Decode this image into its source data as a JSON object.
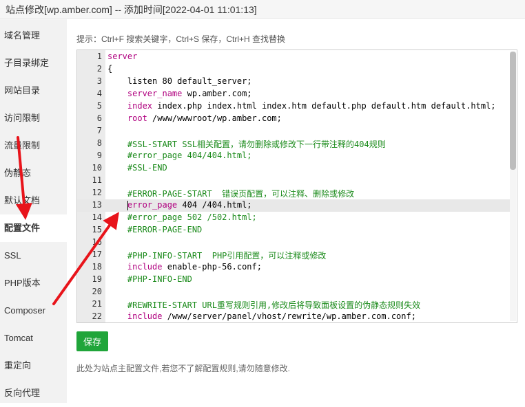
{
  "window": {
    "title": "站点修改[wp.amber.com] -- 添加时间[2022-04-01 11:01:13]"
  },
  "sidebar": {
    "items": [
      {
        "label": "域名管理",
        "active": false
      },
      {
        "label": "子目录绑定",
        "active": false
      },
      {
        "label": "网站目录",
        "active": false
      },
      {
        "label": "访问限制",
        "active": false
      },
      {
        "label": "流量限制",
        "active": false
      },
      {
        "label": "伪静态",
        "active": false
      },
      {
        "label": "默认文档",
        "active": false
      },
      {
        "label": "配置文件",
        "active": true
      },
      {
        "label": "SSL",
        "active": false
      },
      {
        "label": "PHP版本",
        "active": false
      },
      {
        "label": "Composer",
        "active": false
      },
      {
        "label": "Tomcat",
        "active": false
      },
      {
        "label": "重定向",
        "active": false
      },
      {
        "label": "反向代理",
        "active": false
      }
    ]
  },
  "main": {
    "hint": "提示：Ctrl+F 搜索关键字，Ctrl+S 保存，Ctrl+H 查找替换",
    "editor": {
      "current_line": 13,
      "lines": [
        {
          "n": "1",
          "kw": "server",
          "text": "",
          "cm": ""
        },
        {
          "n": "2",
          "kw": "",
          "text": "{",
          "cm": ""
        },
        {
          "n": "3",
          "kw": "",
          "text": "    listen 80 default_server;",
          "cm": ""
        },
        {
          "n": "4",
          "kw": "    server_name",
          "text": " wp.amber.com;",
          "cm": ""
        },
        {
          "n": "5",
          "kw": "    index",
          "text": " index.php index.html index.htm default.php default.htm default.html;",
          "cm": ""
        },
        {
          "n": "6",
          "kw": "    root",
          "text": " /www/wwwroot/wp.amber.com;",
          "cm": ""
        },
        {
          "n": "7",
          "kw": "",
          "text": "",
          "cm": ""
        },
        {
          "n": "8",
          "kw": "",
          "text": "",
          "cm": "    #SSL-START SSL相关配置，请勿删除或修改下一行带注释的404规则"
        },
        {
          "n": "9",
          "kw": "",
          "text": "",
          "cm": "    #error_page 404/404.html;"
        },
        {
          "n": "10",
          "kw": "",
          "text": "",
          "cm": "    #SSL-END"
        },
        {
          "n": "11",
          "kw": "",
          "text": "",
          "cm": ""
        },
        {
          "n": "12",
          "kw": "",
          "text": "",
          "cm": "    #ERROR-PAGE-START  错误页配置，可以注释、删除或修改"
        },
        {
          "n": "13",
          "kw": "    error_page",
          "text": " 404 /404.html;",
          "cm": ""
        },
        {
          "n": "14",
          "kw": "",
          "text": "",
          "cm": "    #error_page 502 /502.html;"
        },
        {
          "n": "15",
          "kw": "",
          "text": "",
          "cm": "    #ERROR-PAGE-END"
        },
        {
          "n": "16",
          "kw": "",
          "text": "",
          "cm": ""
        },
        {
          "n": "17",
          "kw": "",
          "text": "",
          "cm": "    #PHP-INFO-START  PHP引用配置，可以注释或修改"
        },
        {
          "n": "18",
          "kw": "    include",
          "text": " enable-php-56.conf;",
          "cm": ""
        },
        {
          "n": "19",
          "kw": "",
          "text": "",
          "cm": "    #PHP-INFO-END"
        },
        {
          "n": "20",
          "kw": "",
          "text": "",
          "cm": ""
        },
        {
          "n": "21",
          "kw": "",
          "text": "",
          "cm": "    #REWRITE-START URL重写规则引用,修改后将导致面板设置的伪静态规则失效"
        },
        {
          "n": "22",
          "kw": "    include",
          "text": " /www/server/panel/vhost/rewrite/wp.amber.com.conf;",
          "cm": ""
        }
      ]
    },
    "save_label": "保存",
    "note": "此处为站点主配置文件,若您不了解配置规则,请勿随意修改."
  },
  "colors": {
    "accent": "#20a53a",
    "keyword": "#b0007f",
    "comment": "#1a8a1a",
    "annotation_arrow": "#e8141b"
  }
}
